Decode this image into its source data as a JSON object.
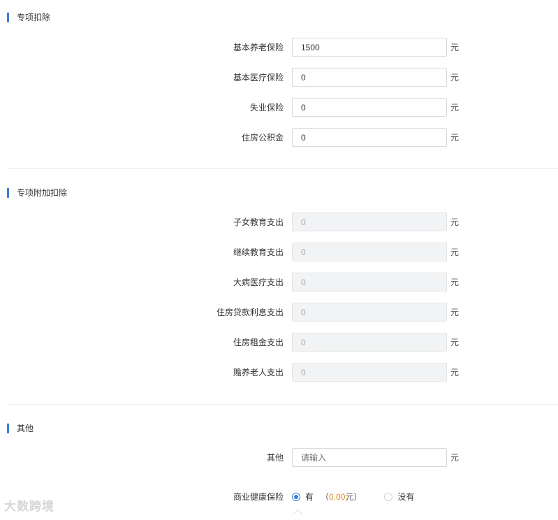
{
  "sections": {
    "special": {
      "title": "专项扣除",
      "items": [
        {
          "label": "基本养老保险",
          "value": "1500",
          "unit": "元"
        },
        {
          "label": "基本医疗保险",
          "value": "0",
          "unit": "元"
        },
        {
          "label": "失业保险",
          "value": "0",
          "unit": "元"
        },
        {
          "label": "住房公积金",
          "value": "0",
          "unit": "元"
        }
      ]
    },
    "additional": {
      "title": "专项附加扣除",
      "items": [
        {
          "label": "子女教育支出",
          "value": "0",
          "unit": "元"
        },
        {
          "label": "继续教育支出",
          "value": "0",
          "unit": "元"
        },
        {
          "label": "大病医疗支出",
          "value": "0",
          "unit": "元"
        },
        {
          "label": "住房贷款利息支出",
          "value": "0",
          "unit": "元"
        },
        {
          "label": "住房租金支出",
          "value": "0",
          "unit": "元"
        },
        {
          "label": "赡养老人支出",
          "value": "0",
          "unit": "元"
        }
      ]
    },
    "other": {
      "title": "其他",
      "other_field": {
        "label": "其他",
        "placeholder": "请输入",
        "unit": "元"
      },
      "insurance": {
        "label": "商业健康保险",
        "option_yes": "有",
        "amount_open": "（",
        "amount_value": "0.00",
        "amount_unit": "元）",
        "option_no": "没有",
        "selected": "有"
      }
    }
  },
  "watermark": "大数跨境",
  "colors": {
    "accent": "#3d7fd8",
    "amount": "#e08a1e",
    "disabled_bg": "#f2f3f5"
  }
}
